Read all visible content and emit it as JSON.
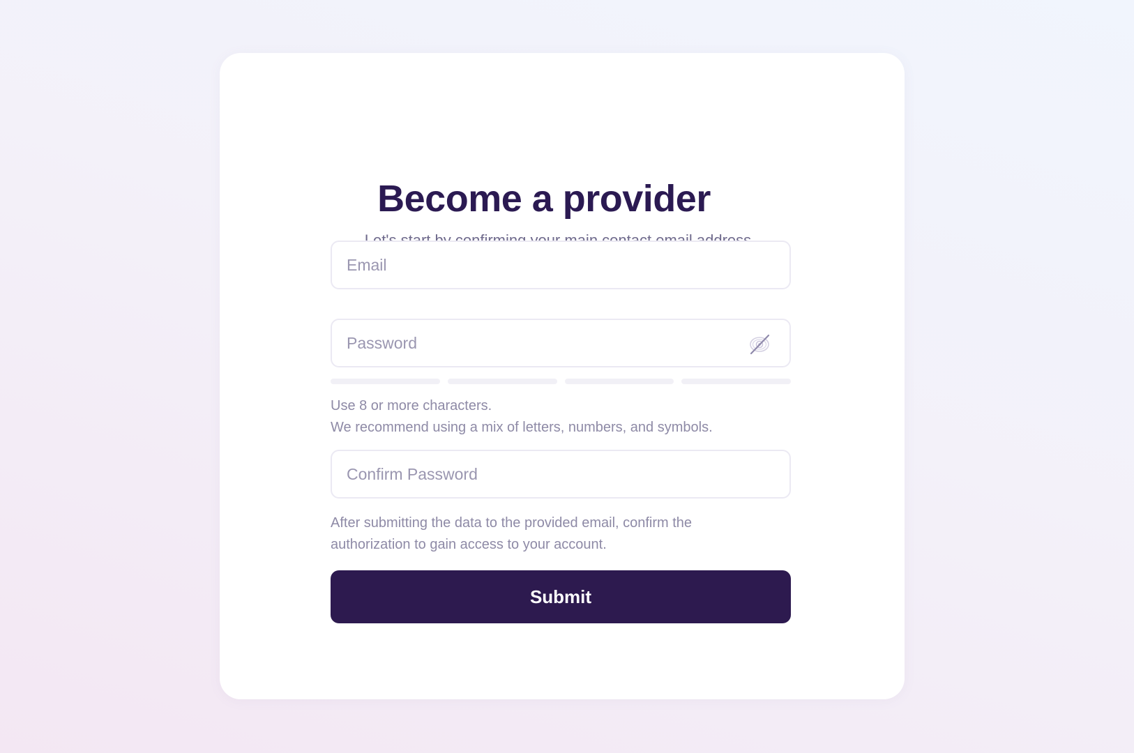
{
  "form": {
    "title": "Become a provider",
    "subtitle": "Let's start by confirming your main contact email address.",
    "email": {
      "placeholder": "Email",
      "value": ""
    },
    "password": {
      "placeholder": "Password",
      "value": "",
      "toggle_icon": "eye-off-icon"
    },
    "password_strength": {
      "segments": 4,
      "filled": 0,
      "empty_color": "#f1f0f6"
    },
    "password_hint_line1": "Use 8 or more characters.",
    "password_hint_line2": "We recommend using a mix of letters, numbers, and symbols.",
    "confirm_password": {
      "placeholder": "Confirm Password",
      "value": ""
    },
    "after_submit_hint": "After submitting the data to the provided email, confirm the authorization to gain access to your account.",
    "submit_label": "Submit"
  },
  "colors": {
    "primary": "#2d1a4f",
    "title": "#2b1a52",
    "subtitle": "#6f6a8c",
    "hint": "#8e8aa6",
    "placeholder": "#9a96b0",
    "field_border": "#ebe9f3"
  }
}
